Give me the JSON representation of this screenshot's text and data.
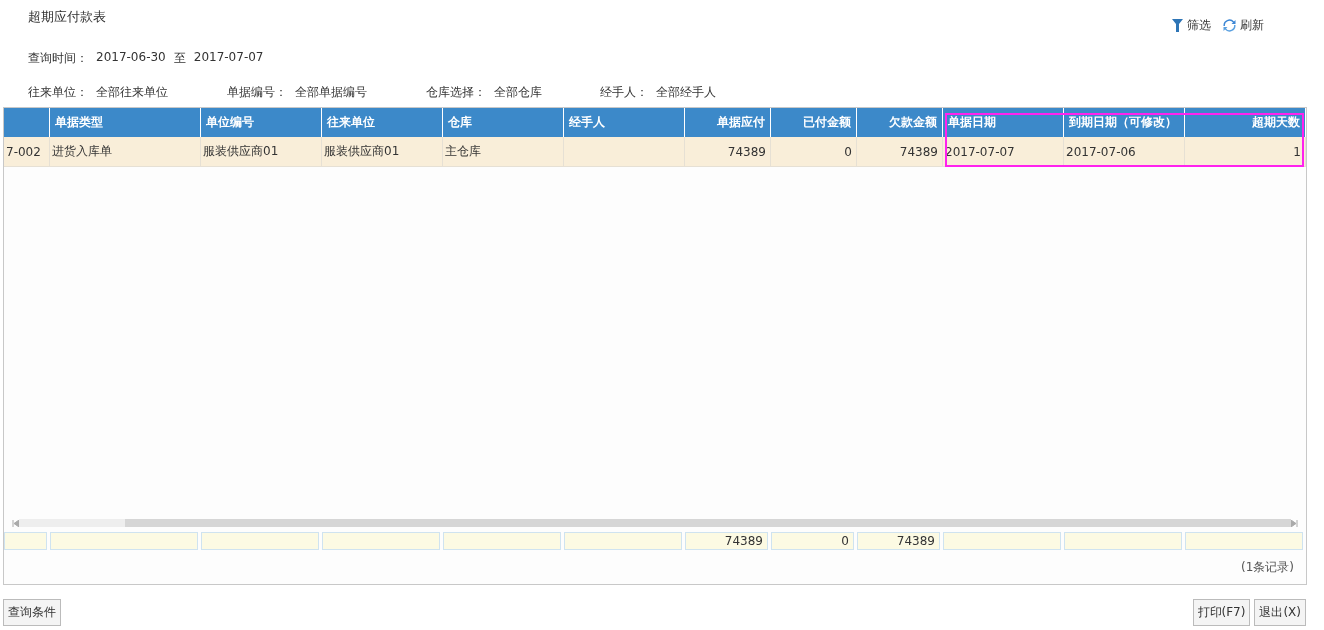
{
  "title": "超期应付款表",
  "toolbar": [
    {
      "kind": "filter",
      "label": "筛选"
    },
    {
      "kind": "refresh",
      "label": "刷新"
    }
  ],
  "query_time": {
    "label": "查询时间：",
    "from": "2017-06-30",
    "separator": "至",
    "to": "2017-07-07"
  },
  "filters": [
    {
      "label": "往来单位：",
      "value": "全部往来单位"
    },
    {
      "label": "单据编号：",
      "value": "全部单据编号"
    },
    {
      "label": "仓库选择：",
      "value": "全部仓库"
    },
    {
      "label": "经手人：",
      "value": "全部经手人"
    }
  ],
  "table": {
    "columns": [
      {
        "kind": "text",
        "highlighted": false
      },
      {
        "label": "单据类型",
        "kind": "text",
        "highlighted": false
      },
      {
        "label": "单位编号",
        "kind": "text",
        "highlighted": false
      },
      {
        "label": "往来单位",
        "kind": "text",
        "highlighted": false
      },
      {
        "label": "仓库",
        "kind": "text",
        "highlighted": false
      },
      {
        "label": "经手人",
        "kind": "text",
        "highlighted": false
      },
      {
        "label": "单据应付",
        "kind": "number",
        "highlighted": false,
        "total": "74389"
      },
      {
        "label": "已付金额",
        "kind": "number",
        "highlighted": false,
        "total": "0"
      },
      {
        "label": "欠款金额",
        "kind": "number",
        "highlighted": false,
        "total": "74389"
      },
      {
        "label": "单据日期",
        "kind": "text",
        "highlighted": true
      },
      {
        "label": "到期日期（可修改）",
        "kind": "text",
        "highlighted": true
      },
      {
        "label": "超期天数",
        "kind": "number",
        "highlighted": true
      }
    ],
    "rows": [
      [
        "7-002",
        "进货入库单",
        "服装供应商01",
        "服装供应商01",
        "主仓库",
        "",
        "74389",
        "0",
        "74389",
        "2017-07-07",
        "2017-07-06",
        "1"
      ]
    ],
    "record_count": "(1条记录)"
  },
  "buttons_left": [
    "查询条件"
  ],
  "buttons_right": [
    "打印(F7)",
    "退出(X)"
  ]
}
